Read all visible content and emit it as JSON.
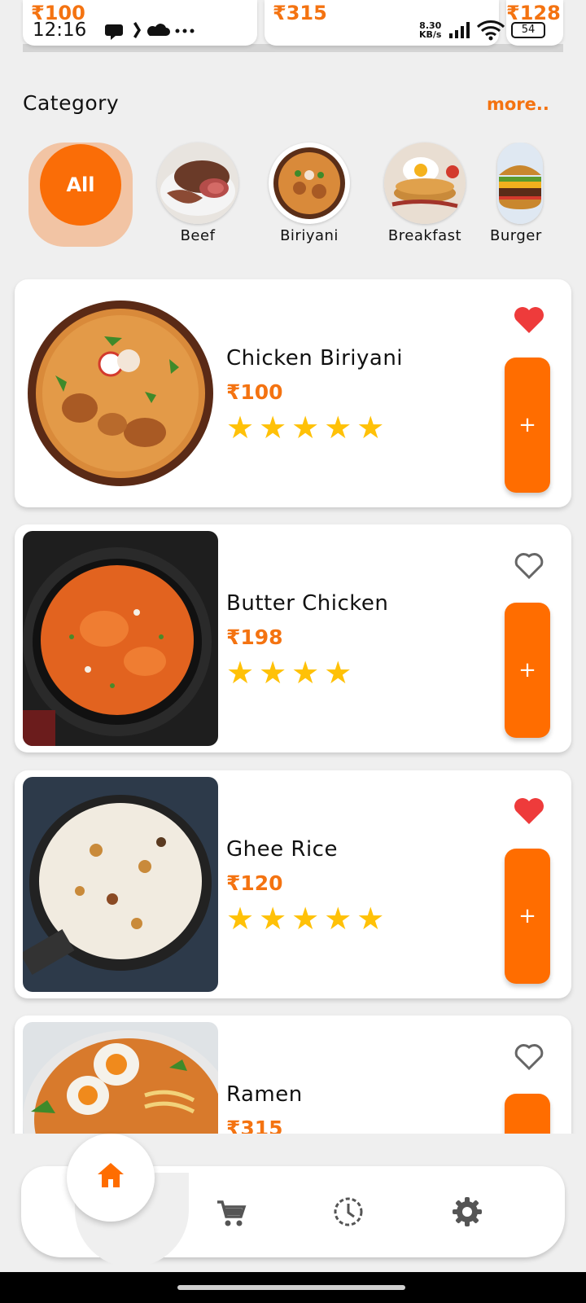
{
  "top_cards": [
    {
      "price": "₹100"
    },
    {
      "price": "₹315"
    },
    {
      "price": "₹128"
    }
  ],
  "status_bar": {
    "time": "12:16",
    "icons": "● ↑ ☁ …",
    "net_speed_value": "8.30",
    "net_speed_unit": "KB/s",
    "battery": "54"
  },
  "category": {
    "title": "Category",
    "more_label": "more..",
    "items": [
      {
        "label": "All"
      },
      {
        "label": "Beef"
      },
      {
        "label": "Biriyani"
      },
      {
        "label": "Breakfast"
      },
      {
        "label": "Burger"
      }
    ]
  },
  "foods": [
    {
      "name": "Chicken Biriyani",
      "price": "₹100",
      "stars": "★★★★★",
      "rating": 5,
      "favorite": true,
      "add_label": "+"
    },
    {
      "name": "Butter Chicken",
      "price": "₹198",
      "stars": "★★★★",
      "rating": 4,
      "favorite": false,
      "add_label": "+"
    },
    {
      "name": "Ghee Rice",
      "price": "₹120",
      "stars": "★★★★★",
      "rating": 5,
      "favorite": true,
      "add_label": "+"
    },
    {
      "name": "Ramen",
      "price": "₹315",
      "stars": "",
      "rating": null,
      "favorite": false,
      "add_label": "+"
    }
  ],
  "nav": {
    "items": [
      "home-icon",
      "cart-icon",
      "history-icon",
      "settings-icon"
    ],
    "active": "home-icon"
  },
  "colors": {
    "accent": "#ff6d00",
    "price": "#f47311",
    "star": "#ffc107",
    "heart": "#ee3b3b",
    "background": "#efefef"
  }
}
